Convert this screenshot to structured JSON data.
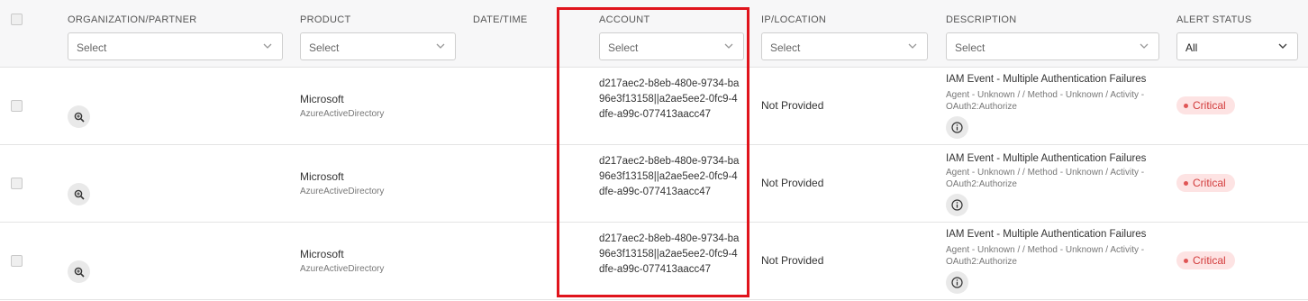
{
  "columns": {
    "organization": "ORGANIZATION/PARTNER",
    "product": "PRODUCT",
    "datetime": "DATE/TIME",
    "account": "ACCOUNT",
    "ip": "IP/LOCATION",
    "description": "DESCRIPTION",
    "alert_status": "ALERT STATUS"
  },
  "filters": {
    "organization": "Select",
    "product": "Select",
    "account": "Select",
    "ip": "Select",
    "description": "Select",
    "alert_status": "All"
  },
  "rows": [
    {
      "product_name": "Microsoft",
      "product_sub": "AzureActiveDirectory",
      "account": "d217aec2-b8eb-480e-9734-ba96e3f13158||a2ae5ee2-0fc9-4dfe-a99c-077413aacc47",
      "ip": "Not Provided",
      "desc_title": "IAM Event - Multiple Authentication Failures",
      "desc_sub": "Agent - Unknown / / Method - Unknown / Activity - OAuth2:Authorize",
      "status": "Critical"
    },
    {
      "product_name": "Microsoft",
      "product_sub": "AzureActiveDirectory",
      "account": "d217aec2-b8eb-480e-9734-ba96e3f13158||a2ae5ee2-0fc9-4dfe-a99c-077413aacc47",
      "ip": "Not Provided",
      "desc_title": "IAM Event - Multiple Authentication Failures",
      "desc_sub": "Agent - Unknown / / Method - Unknown / Activity - OAuth2:Authorize",
      "status": "Critical"
    },
    {
      "product_name": "Microsoft",
      "product_sub": "AzureActiveDirectory",
      "account": "d217aec2-b8eb-480e-9734-ba96e3f13158||a2ae5ee2-0fc9-4dfe-a99c-077413aacc47",
      "ip": "Not Provided",
      "desc_title": "IAM Event - Multiple Authentication Failures",
      "desc_sub": "Agent - Unknown / / Method - Unknown / Activity - OAuth2:Authorize",
      "status": "Critical"
    }
  ],
  "colors": {
    "highlight": "#e0141c",
    "critical_bg": "#fde3e3",
    "critical_text": "#d23b3b"
  },
  "icons": {
    "row_action": "zoom-in-icon",
    "row_info": "info-icon",
    "dropdown": "chevron-down-icon"
  }
}
